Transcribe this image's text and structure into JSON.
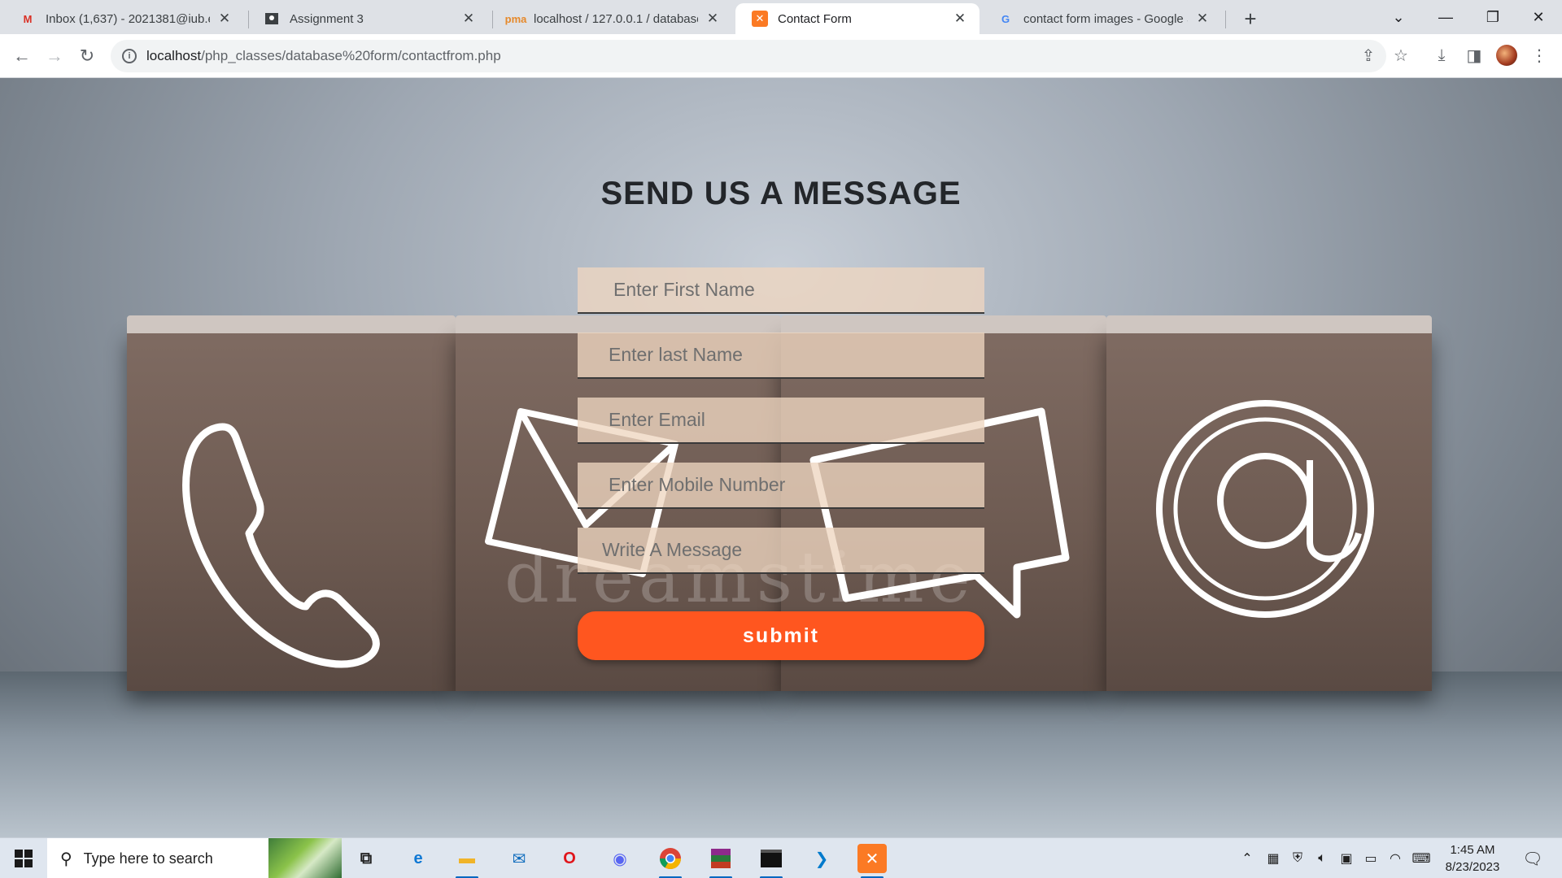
{
  "browser": {
    "tabs": [
      {
        "title": "Inbox (1,637) - 2021381@iub.edu",
        "icon": "gmail-icon",
        "active": false
      },
      {
        "title": "Assignment 3",
        "icon": "classroom-icon",
        "active": false
      },
      {
        "title": "localhost / 127.0.0.1 / database_f",
        "icon": "phpmyadmin-icon",
        "active": false
      },
      {
        "title": "Contact Form",
        "icon": "xampp-icon",
        "active": true
      },
      {
        "title": "contact form images - Google Se",
        "icon": "google-icon",
        "active": false
      }
    ],
    "url_host": "localhost",
    "url_path": "/php_classes/database%20form/contactfrom.php"
  },
  "form": {
    "heading": "SEND US A MESSAGE",
    "first_name_placeholder": "Enter First Name",
    "last_name_placeholder": "Enter last Name",
    "email_placeholder": "Enter Email",
    "mobile_placeholder": "Enter Mobile Number",
    "message_placeholder": "Write A Message",
    "submit_label": "submit"
  },
  "background": {
    "watermark": "dreamstime"
  },
  "taskbar": {
    "search_placeholder": "Type here to search",
    "time": "1:45 AM",
    "date": "8/23/2023"
  },
  "colors": {
    "accent": "#ff561f",
    "field_bg": "#eed6c0",
    "heading": "#23262a"
  }
}
